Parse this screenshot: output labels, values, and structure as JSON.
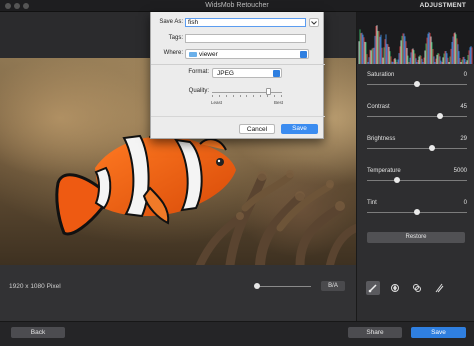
{
  "window": {
    "title": "WidsMob Retoucher",
    "mode_label": "ADJUSTMENT"
  },
  "dialog": {
    "save_as_label": "Save As:",
    "save_as_value": "fish",
    "tags_label": "Tags:",
    "tags_value": "",
    "where_label": "Where:",
    "where_value": "viewer",
    "format_label": "Format:",
    "format_value": "JPEG",
    "quality_label": "Quality:",
    "quality_min_label": "Least",
    "quality_max_label": "Best",
    "quality_level": 0.8,
    "cancel_label": "Cancel",
    "save_label": "Save"
  },
  "canvas": {
    "resolution_label": "1920 x 1080 Pixel",
    "before_after_label": "B/A"
  },
  "adjustments": [
    {
      "label": "Saturation",
      "value": "0",
      "level": 0.5
    },
    {
      "label": "Contrast",
      "value": "45",
      "level": 0.73
    },
    {
      "label": "Brightness",
      "value": "29",
      "level": 0.65
    },
    {
      "label": "Temperature",
      "value": "5000",
      "level": 0.3
    },
    {
      "label": "Tint",
      "value": "0",
      "level": 0.5
    }
  ],
  "panel": {
    "restore_label": "Restore",
    "tools": [
      "brush-icon",
      "fx-icon",
      "layers-icon",
      "settings-sliders-icon"
    ]
  },
  "footer": {
    "back_label": "Back",
    "share_label": "Share",
    "save_label": "Save"
  },
  "colors": {
    "accent": "#2f7fe0",
    "panel_bg": "#2e2e30",
    "dialog_bg": "#ececec"
  }
}
